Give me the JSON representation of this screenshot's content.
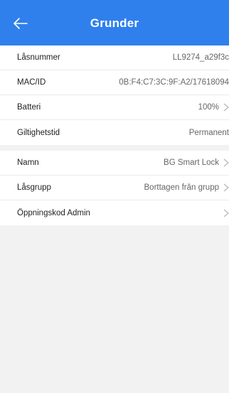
{
  "header": {
    "title": "Grunder",
    "back_icon": "arrow-left-icon"
  },
  "info_group": [
    {
      "label": "Låsnummer",
      "value": "LL9274_a29f3c",
      "chevron": false
    },
    {
      "label": "MAC/ID",
      "value": "0B:F4:C7:3C:9F:A2/17618094",
      "chevron": false
    },
    {
      "label": "Batteri",
      "value": "100%",
      "chevron": true
    },
    {
      "label": "Giltighetstid",
      "value": "Permanent",
      "chevron": false
    }
  ],
  "settings_group": [
    {
      "label": "Namn",
      "value": "BG Smart Lock",
      "chevron": true
    },
    {
      "label": "Låsgrupp",
      "value": "Borttagen från grupp",
      "chevron": true
    },
    {
      "label": "Öppningskod Admin",
      "value": "",
      "chevron": true
    }
  ],
  "colors": {
    "accent": "#2f80ed",
    "background": "#f2f2f2"
  }
}
